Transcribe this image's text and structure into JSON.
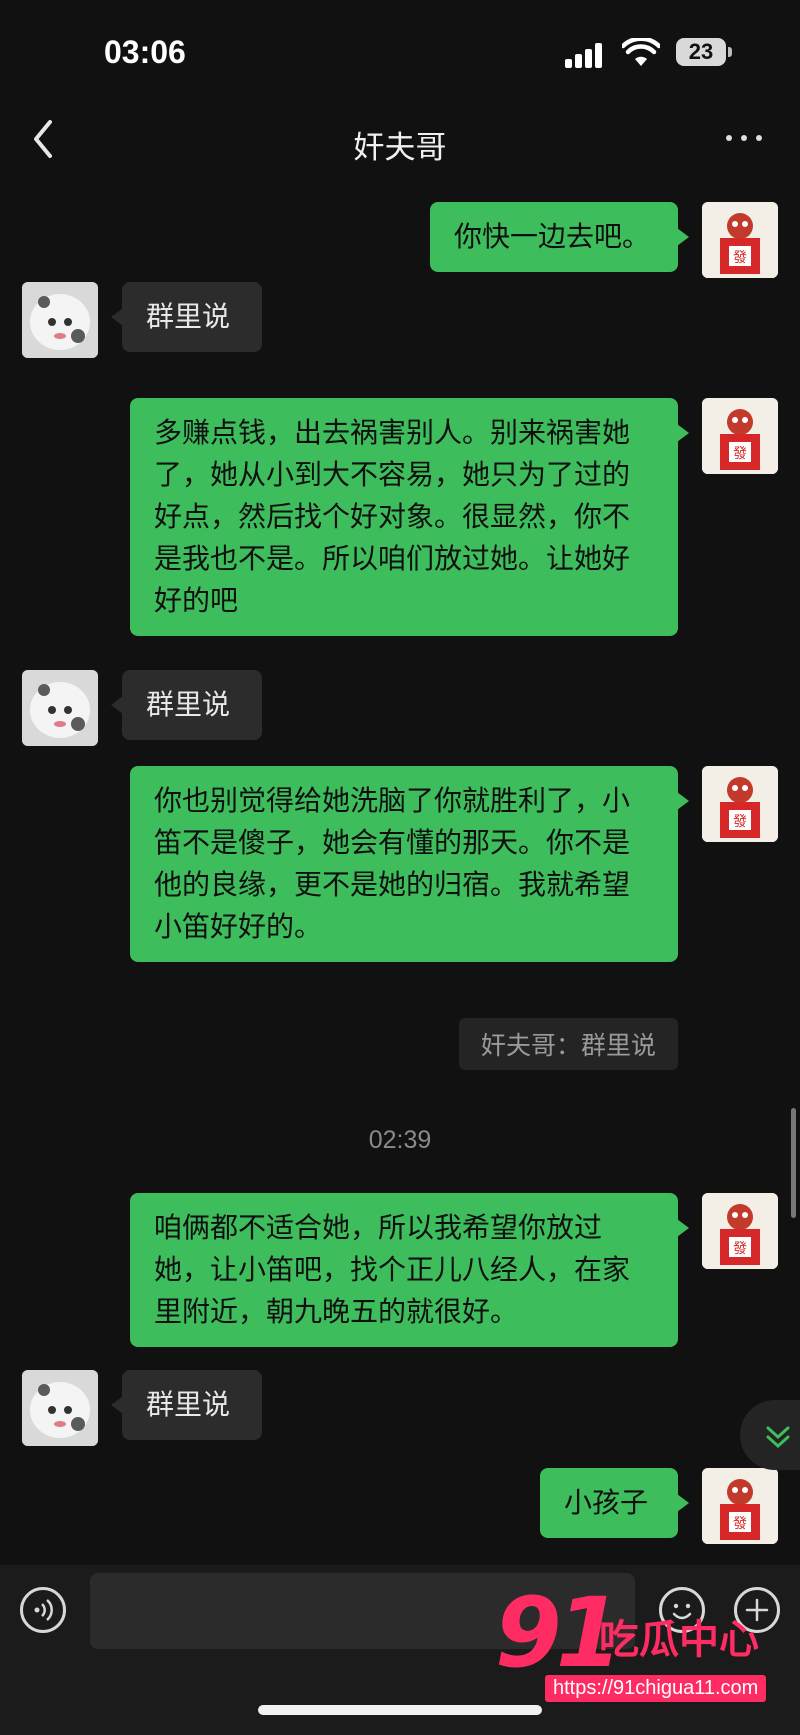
{
  "status_bar": {
    "time": "03:06",
    "battery": "23"
  },
  "header": {
    "title": "奸夫哥"
  },
  "messages": [
    {
      "side": "me",
      "text": "你快一边去吧。"
    },
    {
      "side": "them",
      "text": "群里说"
    },
    {
      "side": "me",
      "text": "多赚点钱，出去祸害别人。别来祸害她了，她从小到大不容易，她只为了过的好点，然后找个好对象。很显然，你不是我也不是。所以咱们放过她。让她好好的吧"
    },
    {
      "side": "them",
      "text": "群里说"
    },
    {
      "side": "me",
      "text": "你也别觉得给她洗脑了你就胜利了，小笛不是傻子，她会有懂的那天。你不是他的良缘，更不是她的归宿。我就希望小笛好好的。"
    },
    {
      "side": "quote",
      "text": "奸夫哥：群里说"
    },
    {
      "side": "time",
      "text": "02:39"
    },
    {
      "side": "me",
      "text": "咱俩都不适合她，所以我希望你放过她，让小笛吧，找个正儿八经人，在家里附近，朝九晚五的就很好。"
    },
    {
      "side": "them",
      "text": "群里说"
    },
    {
      "side": "me",
      "text": "小孩子"
    }
  ],
  "watermark": {
    "number": "91",
    "name": "吃瓜中心",
    "url": "https://91chigua11.com"
  },
  "icons": [
    "back-arrow-icon",
    "more-icon",
    "voice-icon",
    "emoji-icon",
    "plus-icon",
    "scroll-down-icon"
  ]
}
